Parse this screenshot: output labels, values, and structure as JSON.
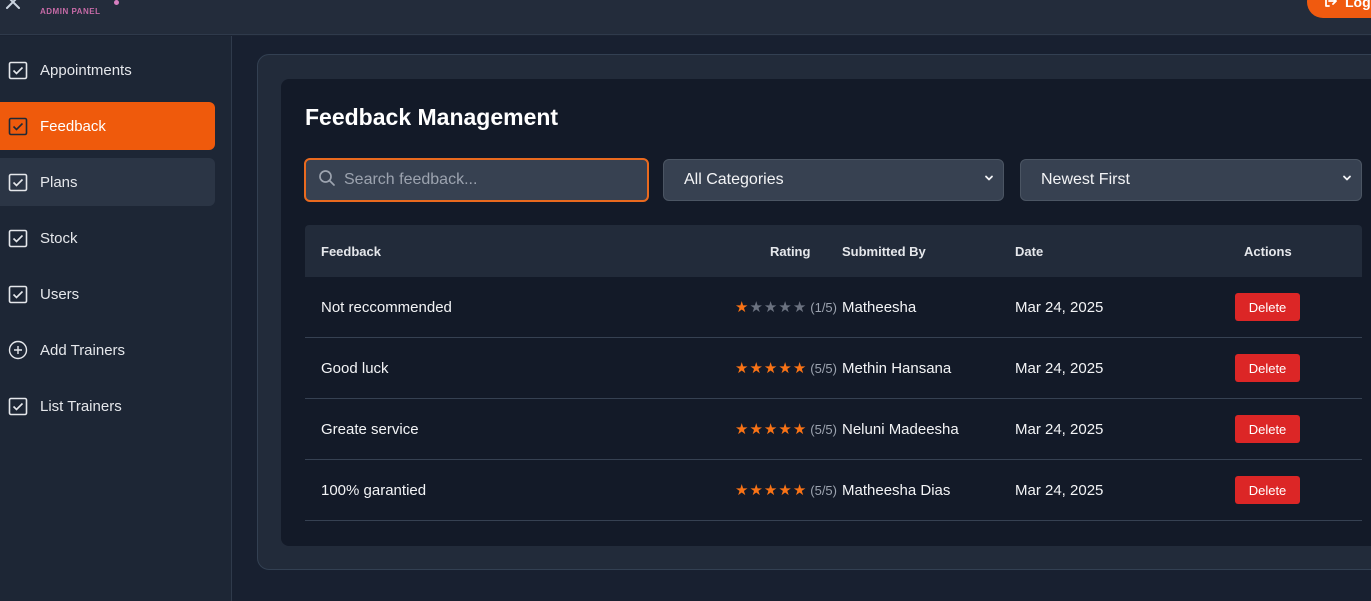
{
  "app": {
    "brand_subtitle": "ADMIN PANEL",
    "logout_label": "Log"
  },
  "sidebar": {
    "items": [
      {
        "label": "Appointments",
        "icon": "calendar-check-icon"
      },
      {
        "label": "Feedback",
        "icon": "calendar-check-icon",
        "state": "active"
      },
      {
        "label": "Plans",
        "icon": "calendar-check-icon",
        "state": "hover"
      },
      {
        "label": "Stock",
        "icon": "calendar-check-icon"
      },
      {
        "label": "Users",
        "icon": "calendar-check-icon"
      },
      {
        "label": "Add Trainers",
        "icon": "plus-circle-icon"
      },
      {
        "label": "List Trainers",
        "icon": "calendar-check-icon"
      }
    ]
  },
  "page": {
    "title": "Feedback Management"
  },
  "filters": {
    "search_placeholder": "Search feedback...",
    "search_value": "",
    "category_selected": "All Categories",
    "sort_selected": "Newest First"
  },
  "table": {
    "headers": {
      "feedback": "Feedback",
      "rating": "Rating",
      "submitted_by": "Submitted By",
      "date": "Date",
      "actions": "Actions"
    },
    "rows": [
      {
        "feedback": "Not reccommended",
        "rating": 1,
        "rating_text": "(1/5)",
        "submitted_by": "Matheesha",
        "date": "Mar 24, 2025",
        "action": "Delete"
      },
      {
        "feedback": "Good luck",
        "rating": 5,
        "rating_text": "(5/5)",
        "submitted_by": "Methin Hansana",
        "date": "Mar 24, 2025",
        "action": "Delete"
      },
      {
        "feedback": "Greate service",
        "rating": 5,
        "rating_text": "(5/5)",
        "submitted_by": "Neluni Madeesha",
        "date": "Mar 24, 2025",
        "action": "Delete"
      },
      {
        "feedback": "100% garantied",
        "rating": 5,
        "rating_text": "(5/5)",
        "submitted_by": "Matheesha Dias",
        "date": "Mar 24, 2025",
        "action": "Delete"
      }
    ]
  },
  "colors": {
    "accent": "#ef5a0c",
    "star_on": "#f97316",
    "star_off": "#6b7280",
    "delete": "#dc2626"
  }
}
